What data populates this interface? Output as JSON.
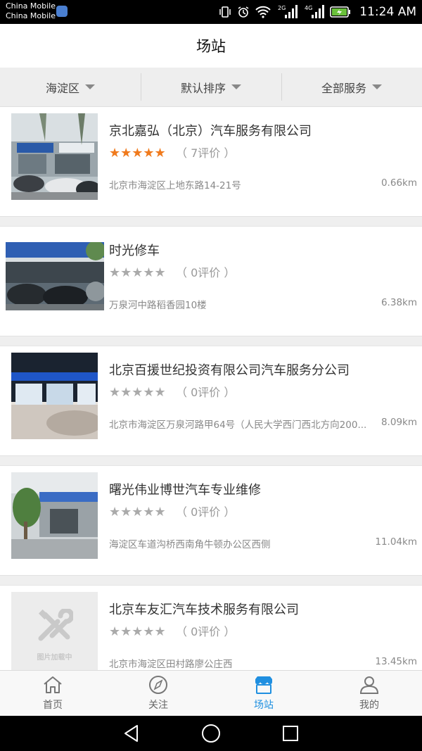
{
  "status_bar": {
    "carrier_1": "China Mobile",
    "carrier_2": "China Mobile",
    "network_1": "2G",
    "network_2": "4G",
    "time": "11:24 AM"
  },
  "header": {
    "title": "场站"
  },
  "filters": [
    {
      "label": "海淀区"
    },
    {
      "label": "默认排序"
    },
    {
      "label": "全部服务"
    }
  ],
  "stations": [
    {
      "name": "京北嘉弘（北京）汽车服务有限公司",
      "rating": 5,
      "reviews": "（ 7评价 ）",
      "address": "北京市海淀区上地东路14-21号",
      "distance": "0.66km"
    },
    {
      "name": "时光修车",
      "rating": 0,
      "reviews": "（ 0评价 ）",
      "address": "万泉河中路稻香园10楼",
      "distance": "6.38km"
    },
    {
      "name": "北京百援世纪投资有限公司汽车服务分公司",
      "rating": 0,
      "reviews": "（ 0评价 ）",
      "address": "北京市海淀区万泉河路甲64号（人民大学西门西北方向200...",
      "distance": "8.09km"
    },
    {
      "name": "曙光伟业博世汽车专业维修",
      "rating": 0,
      "reviews": "（ 0评价 ）",
      "address": "海淀区车道沟桥西南角牛顿办公区西侧",
      "distance": "11.04km"
    },
    {
      "name": "北京车友汇汽车技术服务有限公司",
      "rating": 0,
      "reviews": "（ 0评价 ）",
      "address": "北京市海淀区田村路廖公庄西",
      "distance": "13.45km"
    }
  ],
  "placeholder_text": "图片加载中",
  "star_glyph": "★★★★★",
  "tabs": [
    {
      "label": "首页",
      "icon": "home-icon"
    },
    {
      "label": "关注",
      "icon": "compass-icon"
    },
    {
      "label": "场站",
      "icon": "shop-icon"
    },
    {
      "label": "我的",
      "icon": "user-icon"
    }
  ],
  "colors": {
    "accent": "#1f8fe0",
    "star_on": "#f07a1c",
    "star_off": "#aaaaaa"
  }
}
